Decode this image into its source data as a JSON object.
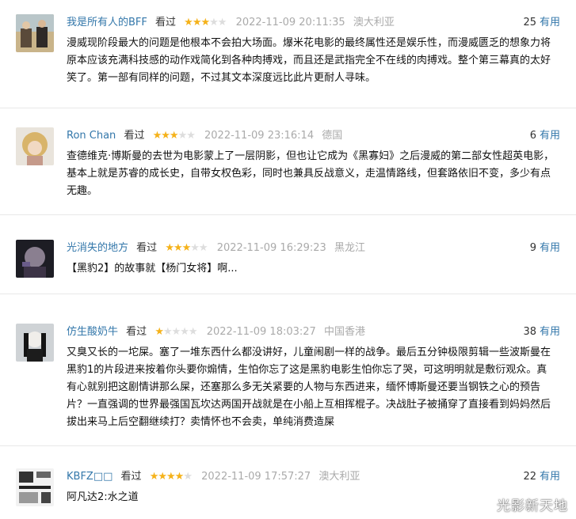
{
  "comments": [
    {
      "user": "我是所有人的BFF",
      "seen": "看过",
      "stars": 3,
      "time": "2022-11-09 20:11:35",
      "location": "澳大利亚",
      "count": "25",
      "useful": "有用",
      "text": "漫威现阶段最大的问题是他根本不会拍大场面。爆米花电影的最终属性还是娱乐性，而漫威匮乏的想象力将原本应该充满科技感的动作戏简化到各种肉搏戏，而且还是武指完全不在线的肉搏戏。整个第三幕真的太好笑了。第一部有同样的问题，不过其文本深度远比此片更耐人寻味。"
    },
    {
      "user": "Ron Chan",
      "seen": "看过",
      "stars": 3,
      "time": "2022-11-09 23:16:14",
      "location": "德国",
      "count": "6",
      "useful": "有用",
      "text": "查德维克·博斯曼的去世为电影蒙上了一层阴影，但也让它成为《黑寡妇》之后漫威的第二部女性超英电影，基本上就是苏睿的成长史，自带女权色彩，同时也兼具反战意义，走温情路线，但套路依旧不变，多少有点无趣。"
    },
    {
      "user": "光消失的地方",
      "seen": "看过",
      "stars": 3,
      "time": "2022-11-09 16:29:23",
      "location": "黑龙江",
      "count": "9",
      "useful": "有用",
      "text": "【黑豹2】的故事就【杨门女将】啊..."
    },
    {
      "user": "仿生酸奶牛",
      "seen": "看过",
      "stars": 1,
      "time": "2022-11-09 18:03:27",
      "location": "中国香港",
      "count": "38",
      "useful": "有用",
      "text": "又臭又长的一坨屎。塞了一堆东西什么都没讲好，儿童闹剧一样的战争。最后五分钟极限剪辑一些波斯曼在黑豹1的片段进来按着你头要你煽情，生怕你忘了这是黑豹电影生怕你忘了哭，可这明明就是敷衍观众。真有心就别把这剧情讲那么屎，还塞那么多无关紧要的人物与东西进来，缅怀博斯曼还要当钢铁之心的预告片？一直强调的世界最强国瓦坎达两国开战就是在小船上互相挥棍子。决战肚子被捅穿了直接看到妈妈然后拔出来马上后空翻继续打？卖情怀也不会卖，单纯消费造屎"
    },
    {
      "user": "KBFZ□□",
      "seen": "看过",
      "stars": 4,
      "time": "2022-11-09 17:57:27",
      "location": "澳大利亚",
      "count": "22",
      "useful": "有用",
      "text": "阿凡达2:水之道"
    }
  ],
  "watermark": "光影新天地",
  "colors": {
    "link": "#3377aa",
    "star": "#f5b21a",
    "meta": "#aaaaaa"
  }
}
